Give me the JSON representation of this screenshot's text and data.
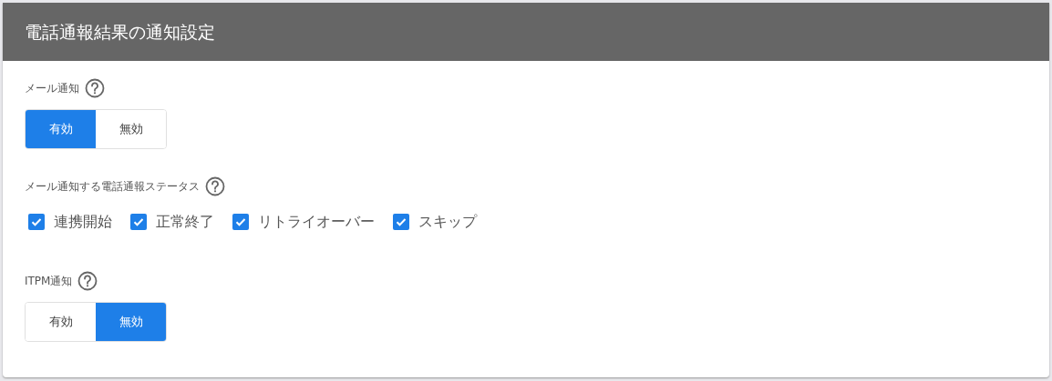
{
  "title": "電話通報結果の通知設定",
  "mail_notification": {
    "label": "メール通知",
    "options": [
      {
        "label": "有効",
        "selected": true
      },
      {
        "label": "無効",
        "selected": false
      }
    ]
  },
  "mail_statuses": {
    "label": "メール通知する電話通報ステータス",
    "items": [
      {
        "label": "連携開始",
        "checked": true
      },
      {
        "label": "正常終了",
        "checked": true
      },
      {
        "label": "リトライオーバー",
        "checked": true
      },
      {
        "label": "スキップ",
        "checked": true
      }
    ]
  },
  "itpm_notification": {
    "label": "ITPM通知",
    "options": [
      {
        "label": "有効",
        "selected": false
      },
      {
        "label": "無効",
        "selected": true
      }
    ]
  }
}
